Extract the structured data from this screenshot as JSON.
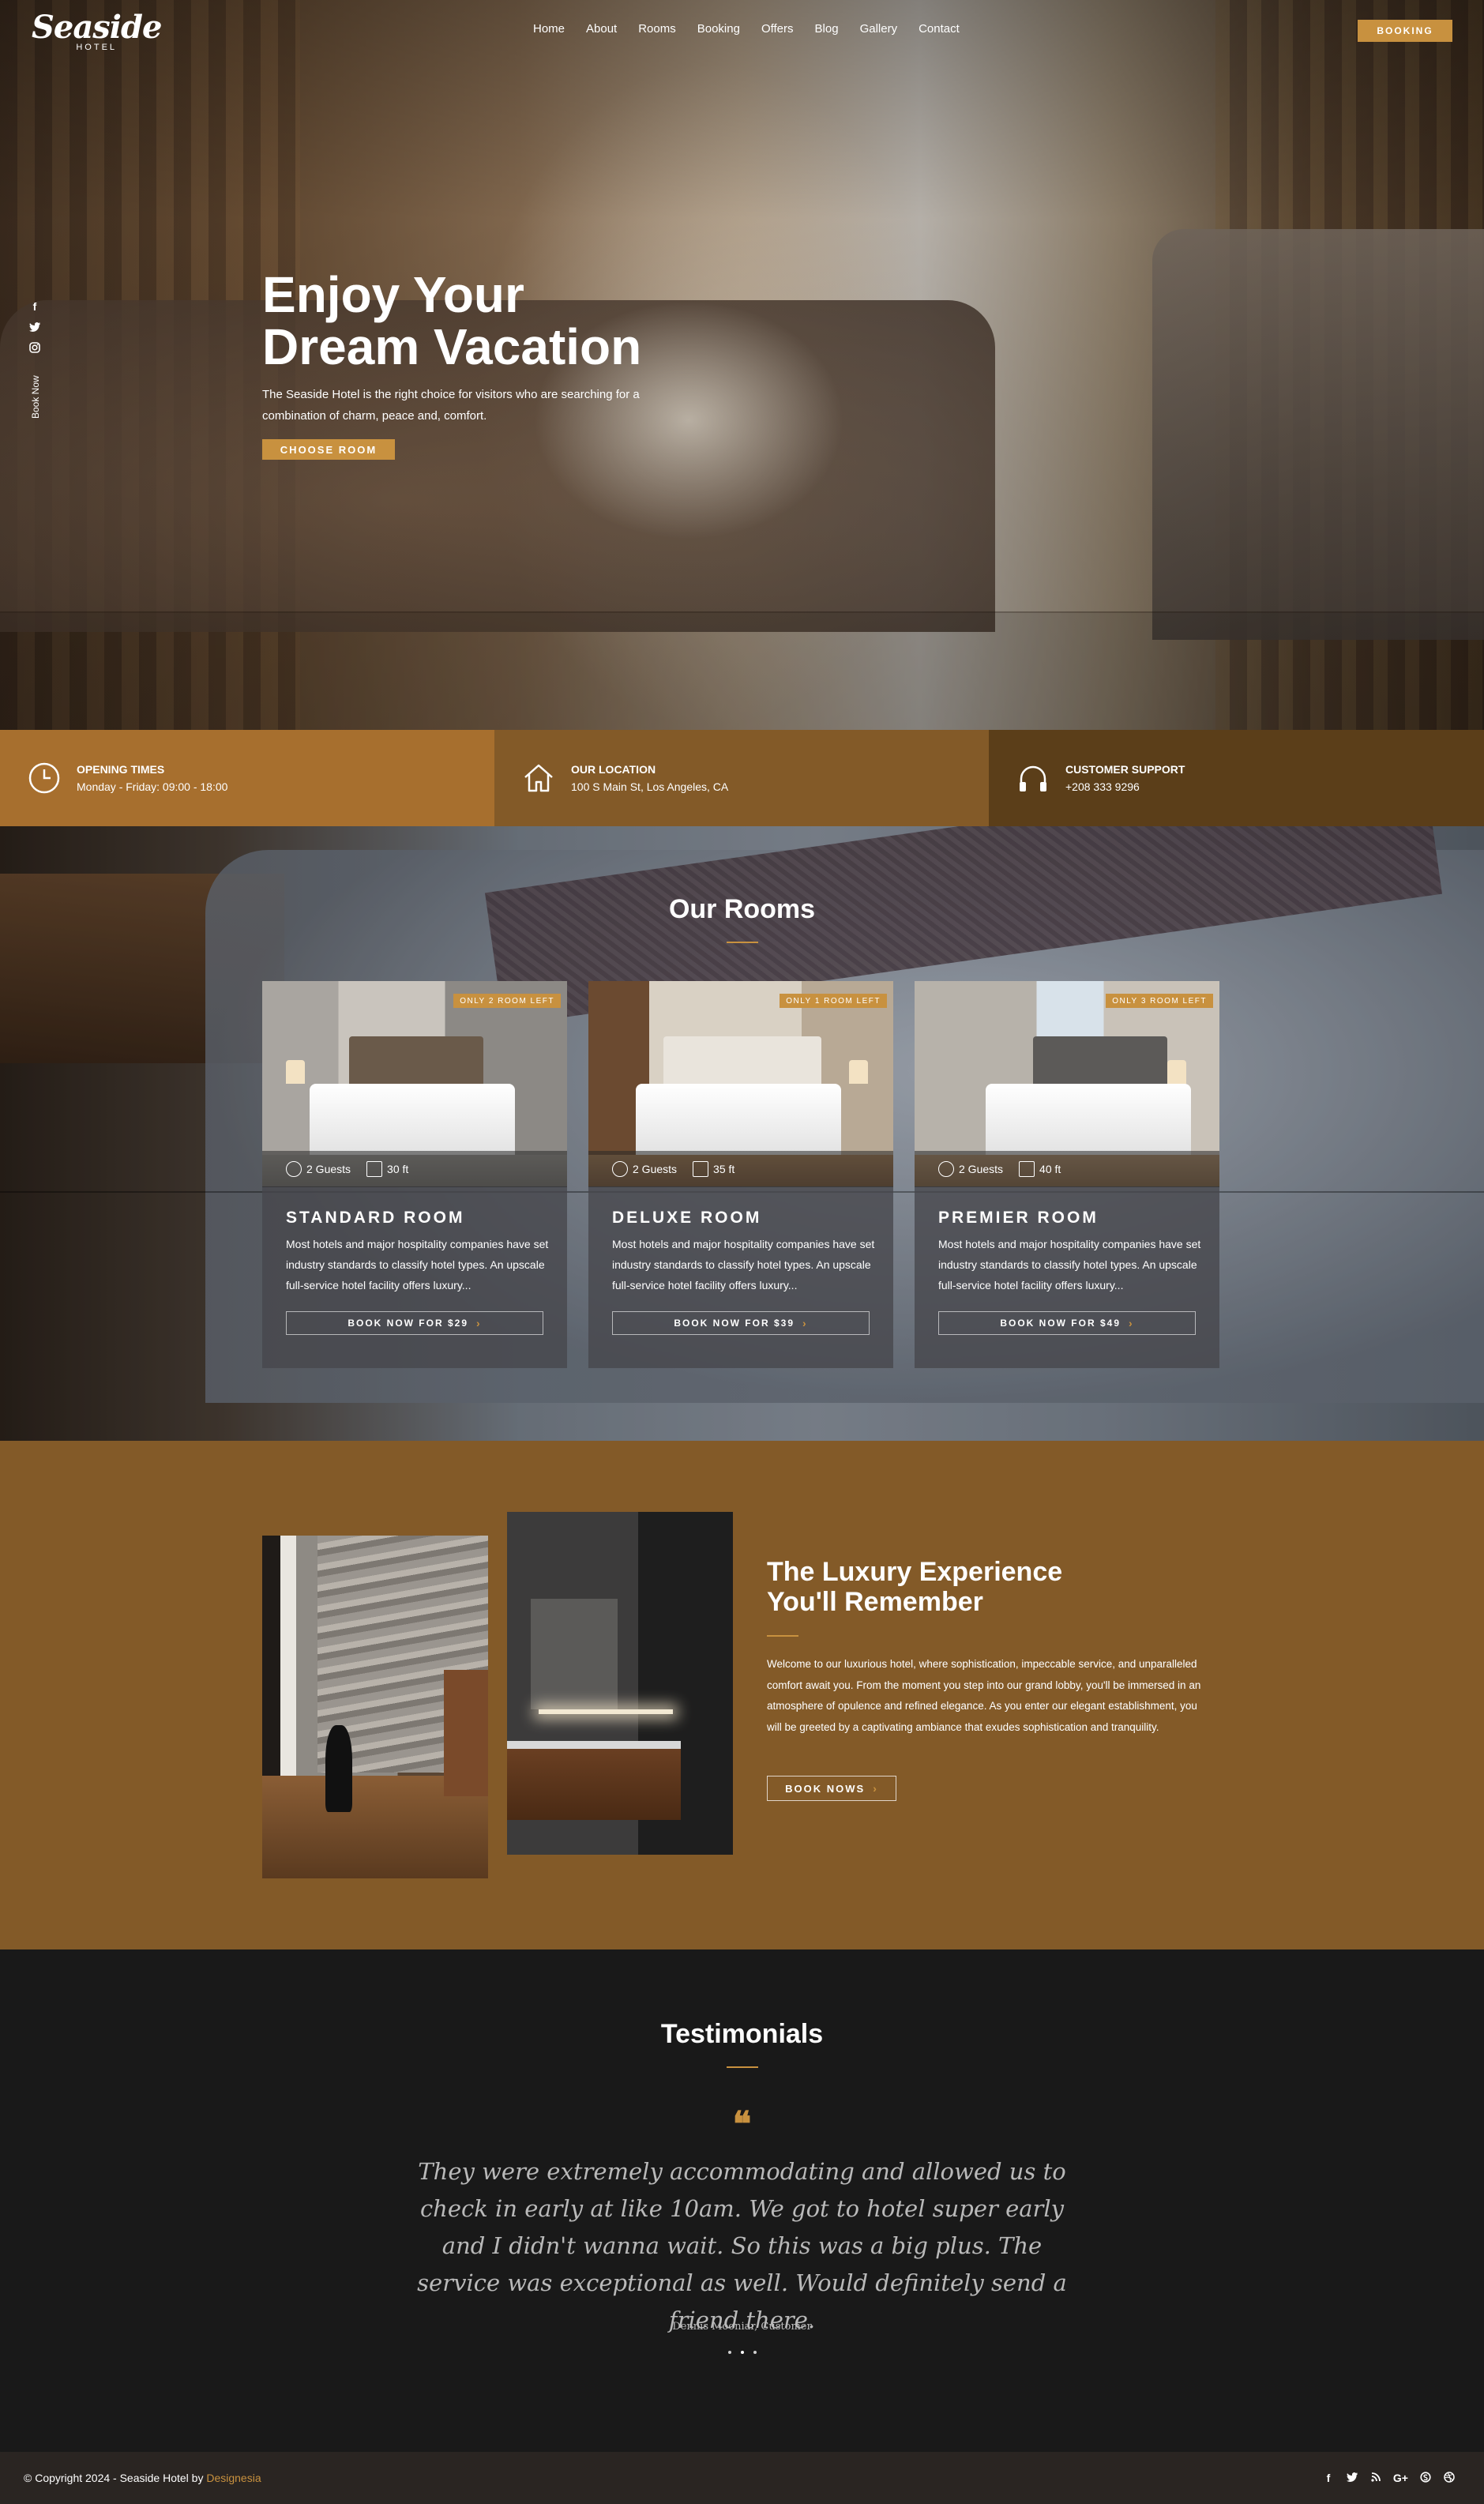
{
  "brand": {
    "name": "Seaside",
    "sub": "HOTEL"
  },
  "nav": [
    "Home",
    "About",
    "Rooms",
    "Booking",
    "Offers",
    "Blog",
    "Gallery",
    "Contact"
  ],
  "header": {
    "booking_label": "BOOKING"
  },
  "side": {
    "book_now": "Book Now",
    "icons": [
      "facebook-icon",
      "twitter-icon",
      "instagram-icon"
    ]
  },
  "hero": {
    "title_line1": "Enjoy Your",
    "title_line2": "Dream Vacation",
    "text_line1": "The Seaside Hotel is the right choice for visitors who are searching for a",
    "text_line2": "combination of charm, peace and, comfort.",
    "cta": "CHOOSE ROOM"
  },
  "info": [
    {
      "title": "OPENING TIMES",
      "value": "Monday - Friday: 09:00 - 18:00",
      "icon": "clock-icon"
    },
    {
      "title": "OUR LOCATION",
      "value": "100 S Main St, Los Angeles, CA",
      "icon": "home-icon"
    },
    {
      "title": "CUSTOMER SUPPORT",
      "value": "+208 333 9296",
      "icon": "headphones-icon"
    }
  ],
  "rooms": {
    "title": "Our Rooms",
    "cards": [
      {
        "badge": "ONLY 2 ROOM LEFT",
        "guests": "2 Guests",
        "size": "30 ft",
        "name": "STANDARD ROOM",
        "desc": "Most hotels and major hospitality companies have set industry standards to classify hotel types. An upscale full-service hotel facility offers luxury...",
        "cta": "BOOK NOW FOR $29"
      },
      {
        "badge": "ONLY 1 ROOM LEFT",
        "guests": "2 Guests",
        "size": "35 ft",
        "name": "DELUXE ROOM",
        "desc": "Most hotels and major hospitality companies have set industry standards to classify hotel types. An upscale full-service hotel facility offers luxury...",
        "cta": "BOOK NOW FOR $39"
      },
      {
        "badge": "ONLY 3 ROOM LEFT",
        "guests": "2 Guests",
        "size": "40 ft",
        "name": "PREMIER ROOM",
        "desc": "Most hotels and major hospitality companies have set industry standards to classify hotel types. An upscale full-service hotel facility offers luxury...",
        "cta": "BOOK NOW FOR $49"
      }
    ]
  },
  "luxury": {
    "title_line1": "The Luxury Experience",
    "title_line2": "You'll Remember",
    "text": "Welcome to our luxurious hotel, where sophistication, impeccable service, and unparalleled comfort await you. From the moment you step into our grand lobby, you'll be immersed in an atmosphere of opulence and refined elegance. As you enter our elegant establishment, you will be greeted by a captivating ambiance that exudes sophistication and tranquility.",
    "cta": "BOOK NOWS"
  },
  "testimonials": {
    "title": "Testimonials",
    "quote": "They were extremely accommodating and allowed us to check in early at like 10am. We got to hotel super early and I didn't wanna wait. So this was a big plus. The service was exceptional as well. Would definitely send a friend there.",
    "author": "Dennis Mooniar, Customer"
  },
  "footer": {
    "copyright": "© Copyright 2024 - Seaside Hotel by",
    "designer": "Designesia",
    "social": [
      "facebook-icon",
      "twitter-icon",
      "rss-icon",
      "google-plus-icon",
      "skype-icon",
      "dribbble-icon"
    ]
  },
  "colors": {
    "accent": "#c8913f",
    "brown": "#835a28",
    "dark": "#191919"
  }
}
